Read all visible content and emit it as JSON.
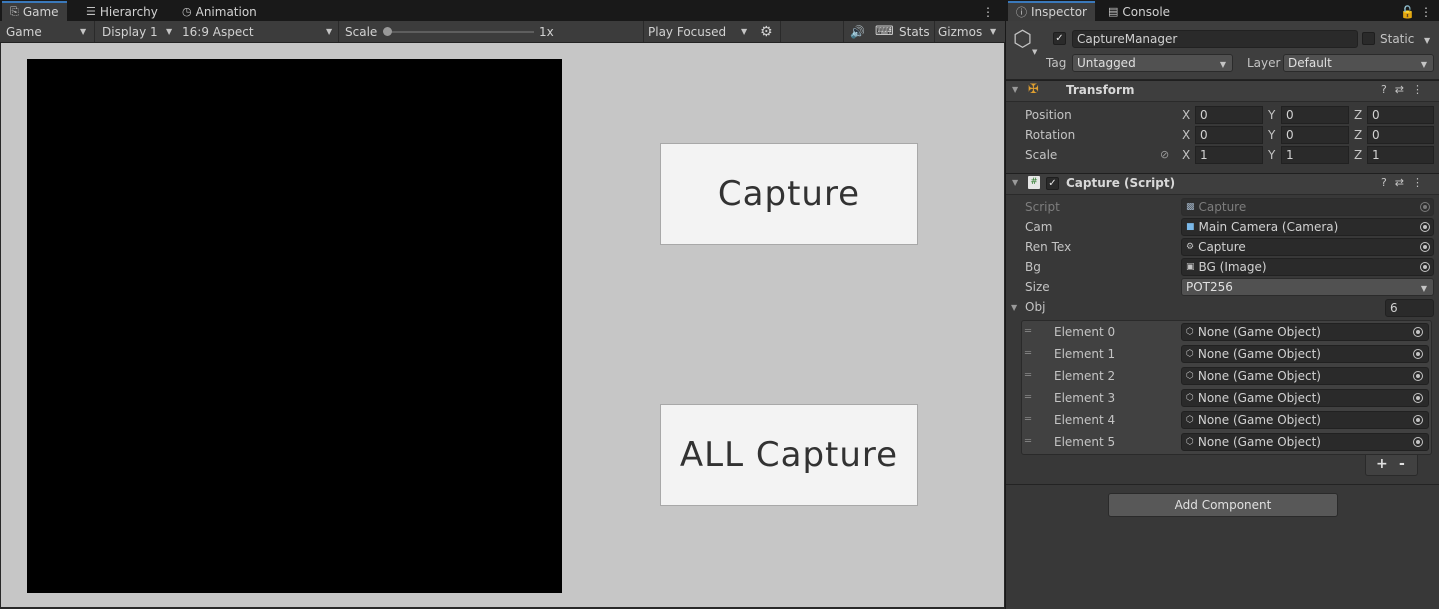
{
  "game_panel": {
    "tabs": [
      {
        "label": "Game",
        "icon": "gamepad-icon",
        "active": true
      },
      {
        "label": "Hierarchy",
        "icon": "list-icon",
        "active": false
      },
      {
        "label": "Animation",
        "icon": "clock-icon",
        "active": false
      }
    ],
    "toolbar": {
      "view_mode": "Game",
      "display": "Display 1",
      "aspect": "16:9 Aspect",
      "scale_label": "Scale",
      "scale_value": "1x",
      "scale_level": 0,
      "play_mode": "Play Focused",
      "stats_label": "Stats",
      "gizmos_label": "Gizmos"
    },
    "buttons": {
      "capture": "Capture",
      "all_capture": "ALL Capture"
    }
  },
  "inspector": {
    "tabs": [
      {
        "label": "Inspector",
        "icon": "info-icon",
        "active": true
      },
      {
        "label": "Console",
        "icon": "console-icon",
        "active": false
      }
    ],
    "object": {
      "name": "CaptureManager",
      "active": true,
      "static_label": "Static",
      "static": false,
      "tag_label": "Tag",
      "tag_value": "Untagged",
      "layer_label": "Layer",
      "layer_value": "Default"
    },
    "transform": {
      "title": "Transform",
      "rows": [
        {
          "label": "Position",
          "x": "0",
          "y": "0",
          "z": "0"
        },
        {
          "label": "Rotation",
          "x": "0",
          "y": "0",
          "z": "0"
        },
        {
          "label": "Scale",
          "x": "1",
          "y": "1",
          "z": "1"
        }
      ],
      "axes": [
        "X",
        "Y",
        "Z"
      ]
    },
    "capture_script": {
      "title": "Capture (Script)",
      "enabled": true,
      "fields": [
        {
          "label": "Script",
          "value": "Capture",
          "dim": true
        },
        {
          "label": "Cam",
          "value": "Main Camera (Camera)"
        },
        {
          "label": "Ren Tex",
          "value": "Capture"
        },
        {
          "label": "Bg",
          "value": "BG (Image)"
        }
      ],
      "size_label": "Size",
      "size_value": "POT256",
      "obj_label": "Obj",
      "obj_count": "6",
      "elements": [
        {
          "label": "Element 0",
          "value": "None (Game Object)"
        },
        {
          "label": "Element 1",
          "value": "None (Game Object)"
        },
        {
          "label": "Element 2",
          "value": "None (Game Object)"
        },
        {
          "label": "Element 3",
          "value": "None (Game Object)"
        },
        {
          "label": "Element 4",
          "value": "None (Game Object)"
        },
        {
          "label": "Element 5",
          "value": "None (Game Object)"
        }
      ],
      "add_symbol": "+",
      "remove_symbol": "-"
    },
    "add_component_label": "Add Component"
  },
  "colors": {
    "accent_tab": "#3a79bb",
    "panel_bg": "#383838",
    "viewport_bg": "#c6c6c6",
    "button_bg": "#f3f3f3"
  }
}
